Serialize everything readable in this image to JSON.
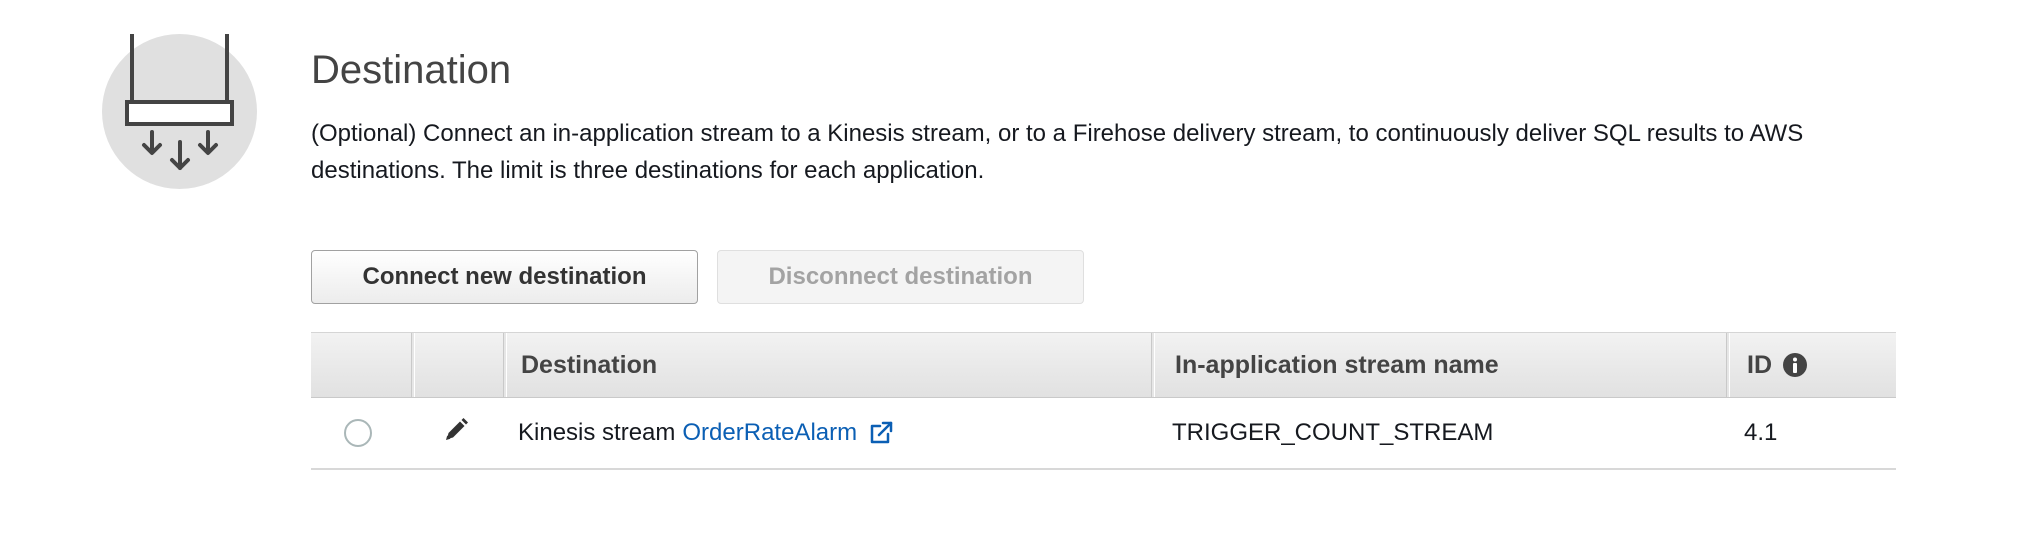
{
  "section": {
    "title": "Destination",
    "description": "(Optional) Connect an in-application stream to a Kinesis stream, or to a Firehose delivery stream, to continuously deliver SQL results to AWS destinations. The limit is three destinations for each application.",
    "hero_icon": "destination-output-icon"
  },
  "toolbar": {
    "connect_label": "Connect new destination",
    "disconnect_label": "Disconnect destination",
    "disconnect_disabled": true
  },
  "table": {
    "columns": [
      {
        "label": ""
      },
      {
        "label": ""
      },
      {
        "label": "Destination"
      },
      {
        "label": "In-application stream name"
      },
      {
        "label": "ID",
        "icon": "info-icon"
      }
    ],
    "rows": [
      {
        "selected": false,
        "edit_icon": "pencil-icon",
        "destination_type": "Kinesis stream",
        "destination_name": "OrderRateAlarm",
        "external_link_icon": "external-link-icon",
        "stream_name": "TRIGGER_COUNT_STREAM",
        "id": "4.1"
      }
    ]
  },
  "colors": {
    "link": "#0b5fb4",
    "icon_circle": "#e0e0e0",
    "icon_stroke": "#444444"
  }
}
